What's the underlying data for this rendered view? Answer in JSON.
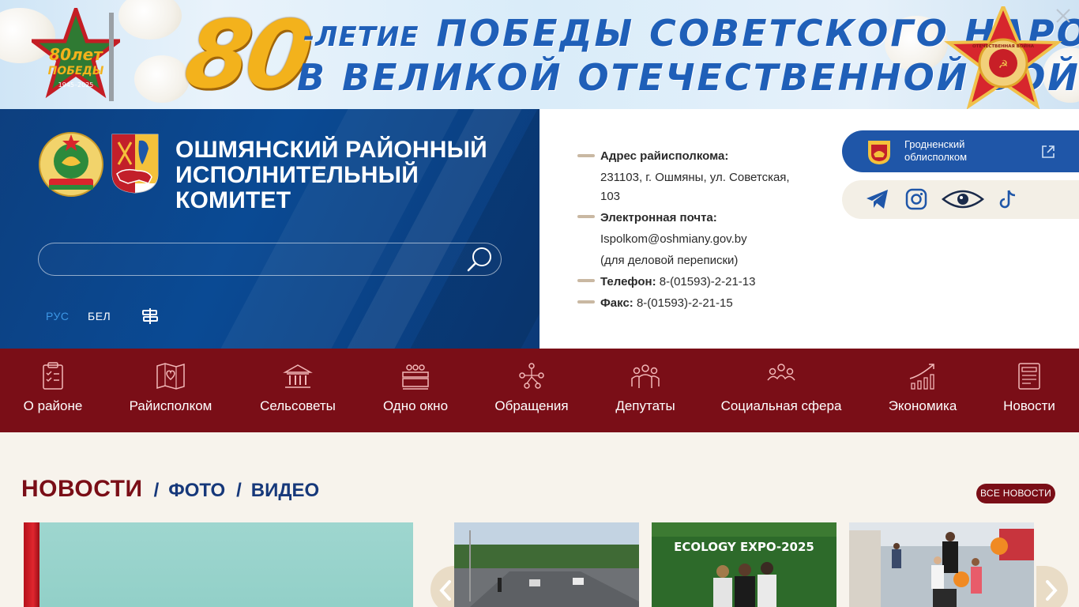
{
  "banner": {
    "number": "80",
    "suffix": "-ЛЕТИЕ",
    "line1_rest": "ПОБЕДЫ СОВЕТСКОГО НАРОДА",
    "line2": "В ВЕЛИКОЙ ОТЕЧЕСТВЕННОЙ ВОЙНЕ",
    "logo_big": "80лет",
    "logo_small": "ПОБЕДЫ",
    "logo_years": "1945–2025",
    "order_text": "ОТЕЧЕСТВЕННАЯ ВОЙНА",
    "close_icon": "close-icon"
  },
  "header": {
    "org_title": "Ошмянский районный исполнительный комитет",
    "search_placeholder": "",
    "search_icon": "search-icon",
    "lang_ru": "РУС",
    "lang_be": "БЕЛ",
    "sitemap_icon": "sitemap-icon"
  },
  "contacts": {
    "address_label": "Адрес райисполкома:",
    "address_line1": "231103, г. Ошмяны, ул. Советская,",
    "address_line2": "103",
    "email_label": "Электронная почта:",
    "email": "Ispolkom@oshmiany.gov.by",
    "email_note": "(для деловой переписки)",
    "phone_label": "Телефон:",
    "phone": "8-(01593)-2-21-13",
    "fax_label": "Факс:",
    "fax": "8-(01593)-2-21-15"
  },
  "region": {
    "line1": "Гродненский",
    "line2": "облисполком"
  },
  "social": [
    "telegram-icon",
    "instagram-icon",
    "eye-icon",
    "tiktok-icon"
  ],
  "nav": [
    {
      "label": "О районе",
      "icon": "clipboard-icon"
    },
    {
      "label": "Райисполком",
      "icon": "map-heart-icon"
    },
    {
      "label": "Сельсоветы",
      "icon": "building-icon"
    },
    {
      "label": "Одно окно",
      "icon": "service-desk-icon"
    },
    {
      "label": "Обращения",
      "icon": "network-icon"
    },
    {
      "label": "Депутаты",
      "icon": "people-group-icon"
    },
    {
      "label": "Социальная сфера",
      "icon": "social-icon"
    },
    {
      "label": "Экономика",
      "icon": "chart-growth-icon"
    },
    {
      "label": "Новости",
      "icon": "newspaper-icon"
    }
  ],
  "news": {
    "title": "НОВОСТИ",
    "sep": "/",
    "tab_photo": "ФОТО",
    "tab_video": "ВИДЕО",
    "all_news": "ВСЕ НОВОСТИ",
    "thumb2_caption": "ECOLOGY EXPO-2025"
  },
  "colors": {
    "header_blue": "#0a4a94",
    "nav_red": "#7a0e17",
    "region_blue": "#1f56a8",
    "page_bg": "#f7f3ec"
  }
}
